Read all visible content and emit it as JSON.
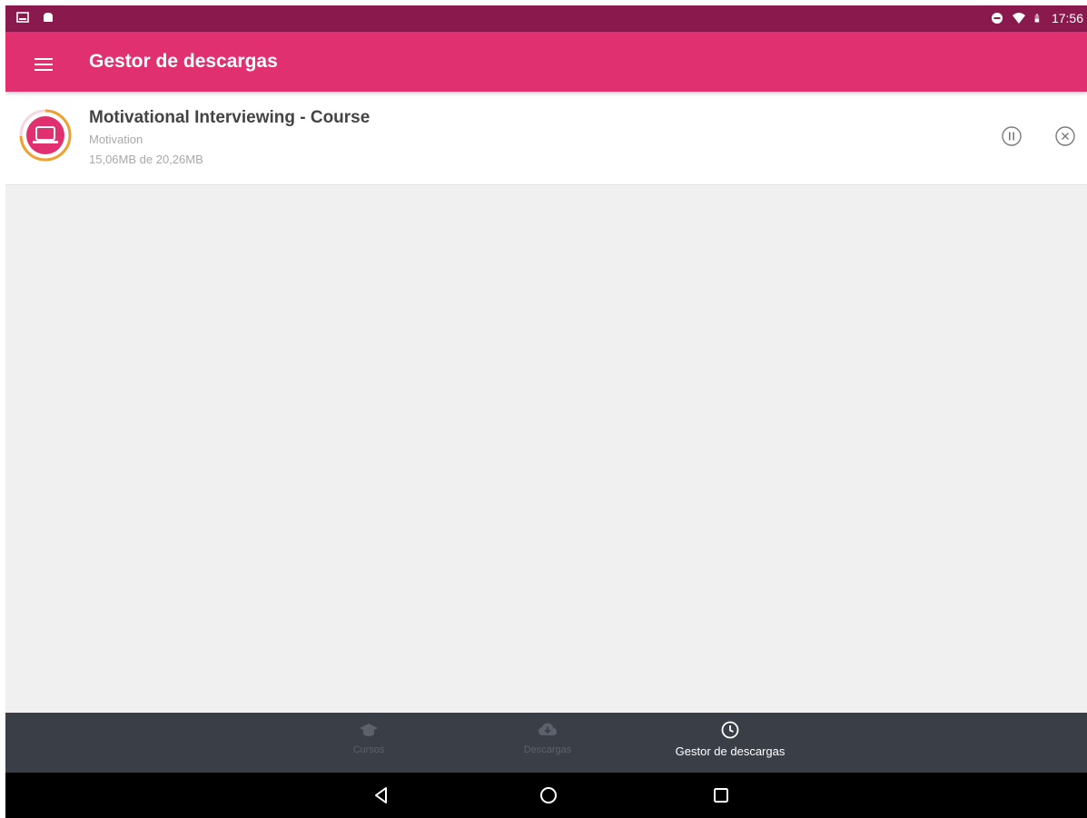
{
  "status_bar": {
    "time": "17:56",
    "left_icons": [
      "image-icon",
      "android-icon"
    ],
    "right_icons": [
      "do-not-disturb-icon",
      "wifi-icon",
      "battery-icon"
    ],
    "background": "#8a1a4d"
  },
  "app_bar": {
    "title": "Gestor de descargas",
    "menu_icon": "hamburger-menu-icon",
    "background": "#e0306f"
  },
  "downloads": [
    {
      "title": "Motivational Interviewing - Course",
      "subtitle": "Motivation",
      "size_text": "15,06MB de 20,26MB",
      "progress": 0.743,
      "icon": "laptop-icon",
      "accent_color": "#e0306f",
      "progress_color": "#f0a030",
      "actions": [
        "pause-icon",
        "cancel-icon"
      ]
    }
  ],
  "bottom_nav": {
    "items": [
      {
        "label": "Cursos",
        "icon": "graduation-cap-icon",
        "active": false
      },
      {
        "label": "Descargas",
        "icon": "cloud-download-icon",
        "active": false
      },
      {
        "label": "Gestor de descargas",
        "icon": "clock-icon",
        "active": true
      }
    ],
    "background": "#3a3e47"
  },
  "system_nav": {
    "buttons": [
      "back-icon",
      "home-icon",
      "recents-icon"
    ]
  }
}
